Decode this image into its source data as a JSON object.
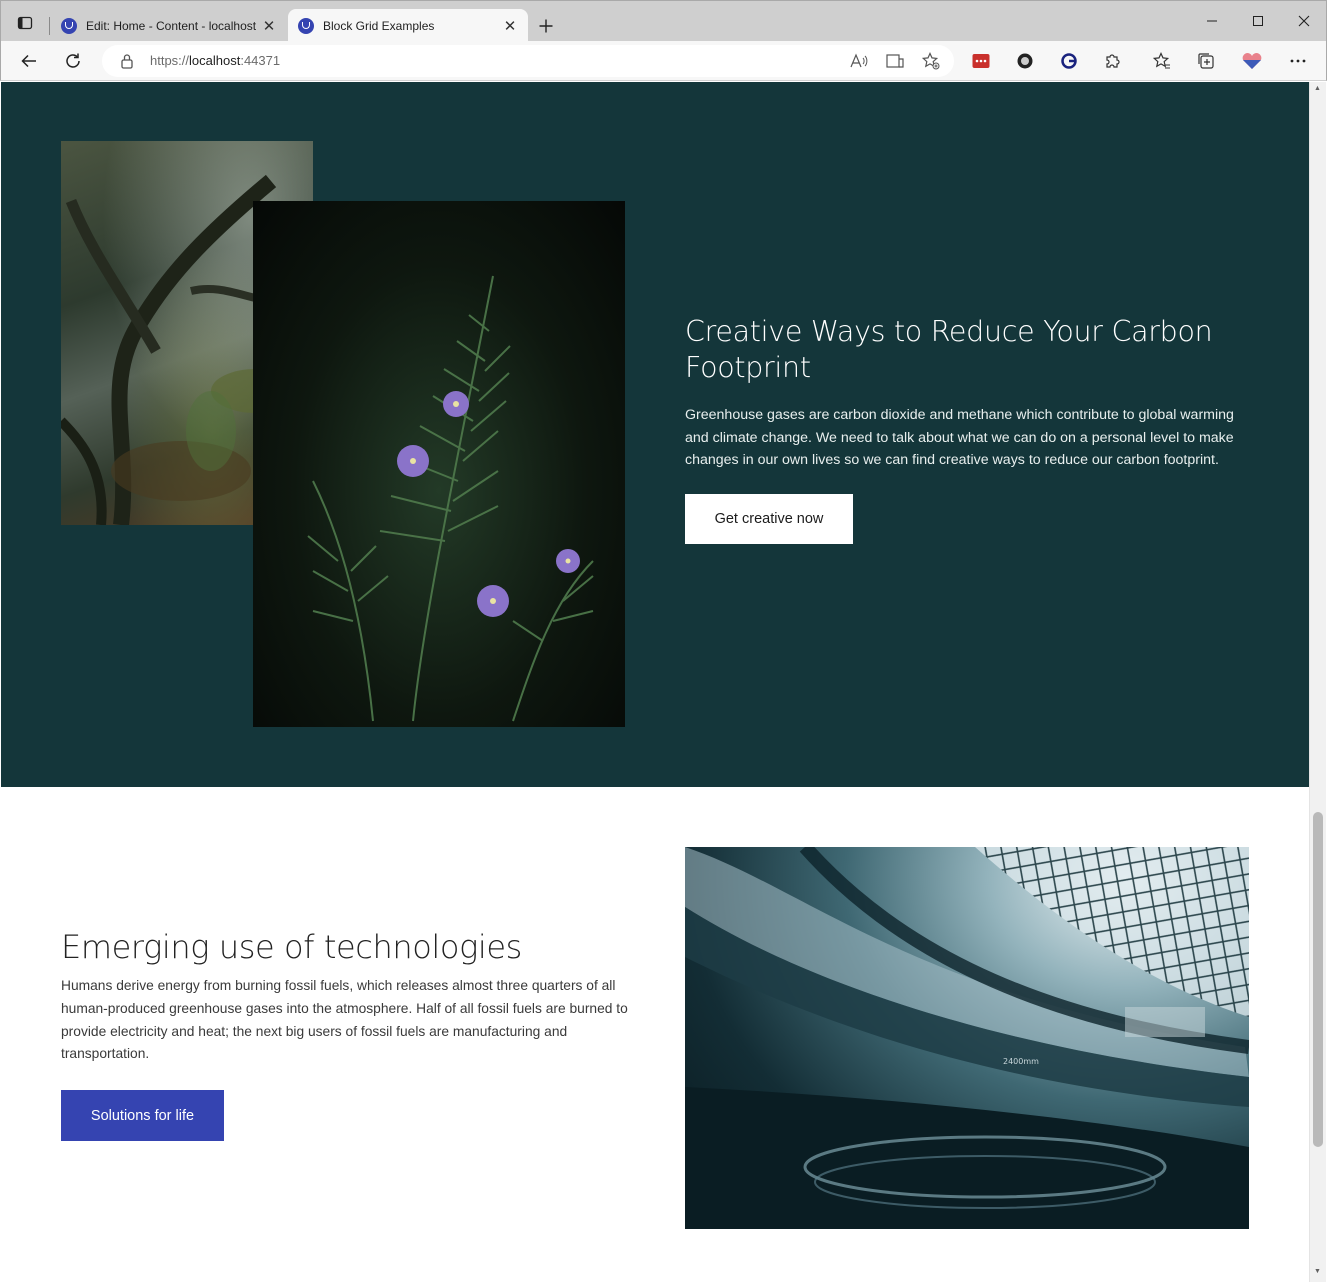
{
  "browser": {
    "tabs": [
      {
        "label": "Edit: Home - Content - localhost",
        "active": false
      },
      {
        "label": "Block Grid Examples",
        "active": true
      }
    ],
    "address": {
      "scheme": "https://",
      "host": "localhost",
      "port": ":44371"
    },
    "accent_color": "#3544b1"
  },
  "hero": {
    "background_color": "#14363a",
    "title": "Creative Ways to Reduce Your Carbon Footprint",
    "body": "Greenhouse gases are carbon dioxide and methane which contribute to global warming and climate change. We need to talk about what we can do on a personal level to make changes in our own lives so we can find creative ways to reduce our carbon footprint.",
    "button_label": "Get creative now"
  },
  "section2": {
    "title": "Emerging use of technologies",
    "body": "Humans derive energy from burning fossil fuels, which releases almost three quarters of all human-produced greenhouse gases into the atmosphere. Half of all fossil fuels are burned to provide electricity and heat; the next big users of fossil fuels are manufacturing and transportation.",
    "button_label": "Solutions for life",
    "button_color": "#3544b1",
    "image_text": "2400mm"
  }
}
